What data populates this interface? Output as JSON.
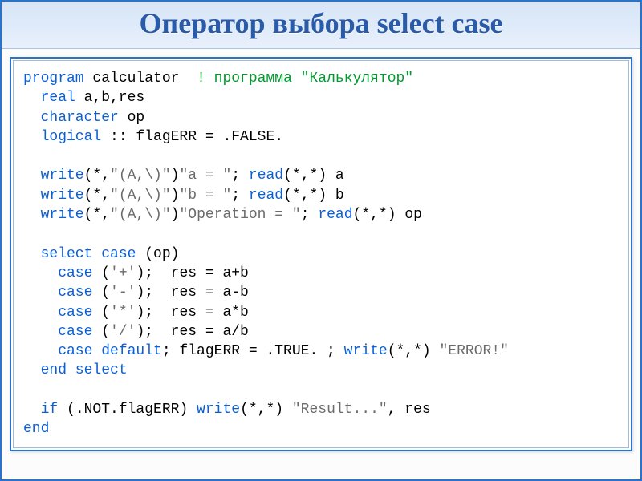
{
  "title": "Оператор выбора select case",
  "code": {
    "t": {
      "program": "program",
      "calc": " calculator  ",
      "cm1": "! программа \"Калькулятор\"",
      "real": "  real",
      "vars1": " a,b,res",
      "character": "  character",
      "vars2": " op",
      "logical": "  logical",
      "vars3": " :: flagERR = .FALSE.",
      "write1a": "  write",
      "write1b": "(*,",
      "write1c": "\"(A,\\)\"",
      "write1d": ")",
      "write1e": "\"a = \"",
      "write1f": "; ",
      "read": "read",
      "readargs": "(*,*) a",
      "write2e": "\"b = \"",
      "readargs2": "(*,*) b",
      "write3e": "\"Operation = \"",
      "readargs3": "(*,*) op",
      "select": "  select case",
      "selectarg": " (op)",
      "case": "    case",
      "case1a": " (",
      "c1": "'+'",
      "case_end": ");  res = a+b",
      "c2": "'-'",
      "case_end2": ");  res = a-b",
      "c3": "'*'",
      "case_end3": ");  res = a*b",
      "c4": "'/'",
      "case_end4": ");  res = a/b",
      "cased": "    case default",
      "casedrest": "; flagERR = .TRUE. ; ",
      "writekw": "write",
      "writeargs_err": "(*,*) ",
      "s_err": "\"ERROR!\"",
      "endsel": "  end select",
      "if": "  if",
      "ifargs": " (.NOT.flagERR) ",
      "s_res": "\"Result...\"",
      "tail": ", res",
      "end": "end"
    }
  }
}
